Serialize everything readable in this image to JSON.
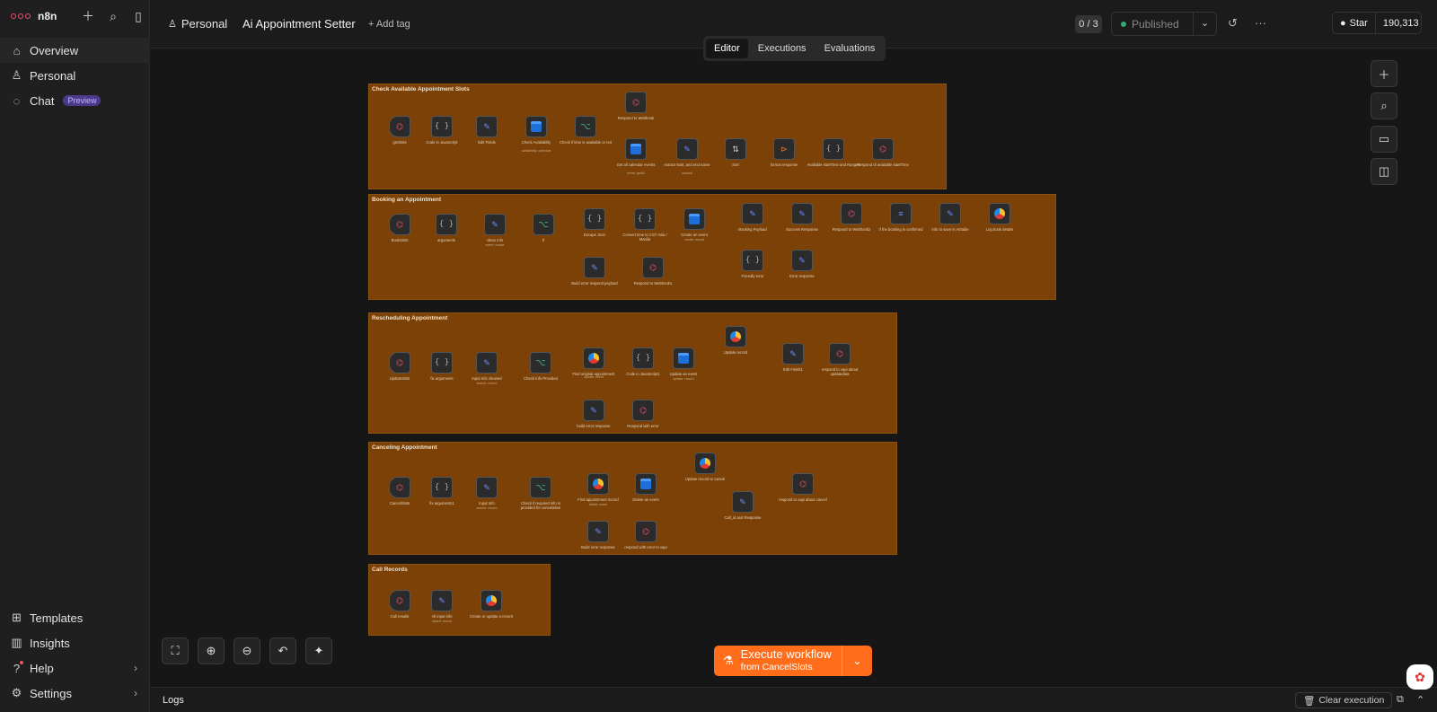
{
  "app": {
    "name": "n8n"
  },
  "sidebar": {
    "items": [
      {
        "label": "Overview"
      },
      {
        "label": "Personal"
      },
      {
        "label": "Chat",
        "badge": "Preview"
      }
    ],
    "bottom": [
      {
        "label": "Templates"
      },
      {
        "label": "Insights"
      },
      {
        "label": "Help"
      },
      {
        "label": "Settings"
      }
    ]
  },
  "header": {
    "project": "Personal",
    "workflow_title": "Ai Appointment Setter",
    "add_tag": "+ Add tag",
    "counter": "0 / 3",
    "publish_label": "Published",
    "github_star": "Star",
    "github_count": "190,313"
  },
  "tabs": [
    {
      "label": "Editor",
      "active": true
    },
    {
      "label": "Executions"
    },
    {
      "label": "Evaluations"
    }
  ],
  "groups": [
    {
      "title": "Check Available Appointment Slots",
      "labels": [
        "getSlots",
        "Code in JavaScript",
        "Edit Fields",
        "Check Availability",
        "Check if time is available or not",
        "Respond to Webhook",
        "Get all calendar events",
        "extract start, and end name",
        "Sort",
        "format response",
        "Available startTime and Ranges",
        "Respond of available startTime"
      ],
      "sublabels": [
        "availability: calendar",
        "event: getAll",
        "manual"
      ]
    },
    {
      "title": "Booking an Appointment",
      "labels": [
        "BookSlots",
        "arguments",
        "clean Info",
        "If",
        "Escape Json",
        "Convert time to CST Asia / Manila",
        "Create an event",
        "Booking Payload",
        "Success Response",
        "Respond to Webhook2",
        "If the booking is confirmed",
        "Info to save in Airtable",
        "Log book details",
        "Build error respond payload",
        "Respond to Webhook1",
        "Friendly error",
        "Error response"
      ],
      "sublabels": [
        "event: create",
        "create: record"
      ]
    },
    {
      "title": "Rescheduling Appointment",
      "labels": [
        "UpdateSlots",
        "fix arguments",
        "Input Info cleaned",
        "Check Info Provided",
        "Find original appointment",
        "Code in JavaScript1",
        "Update an event",
        "Update record",
        "Edit Fields1",
        "respond to vapi about updatedata",
        "build error response",
        "Respond with error"
      ],
      "sublabels": [
        "search: record",
        "update: event",
        "update: record"
      ]
    },
    {
      "title": "Canceling Appointment",
      "labels": [
        "CancelSlots",
        "fix arguments1",
        "Input Info",
        "Check if required info is provided for cancelation",
        "Find appointment record",
        "Delete an event",
        "Update record to cancel",
        "Call_id and Response",
        "respond to vapi about cancel",
        "Build error response",
        "respond with error to vapi"
      ],
      "sublabels": [
        "search: record",
        "delete: event"
      ]
    },
    {
      "title": "Call Records",
      "labels": [
        "Call results",
        "All input info",
        "Create or update a record"
      ],
      "sublabels": [
        "upsert: record"
      ]
    }
  ],
  "execute": {
    "title": "Execute workflow",
    "subtitle": "from CancelSlots"
  },
  "logs": {
    "title": "Logs",
    "clear": "Clear execution"
  }
}
